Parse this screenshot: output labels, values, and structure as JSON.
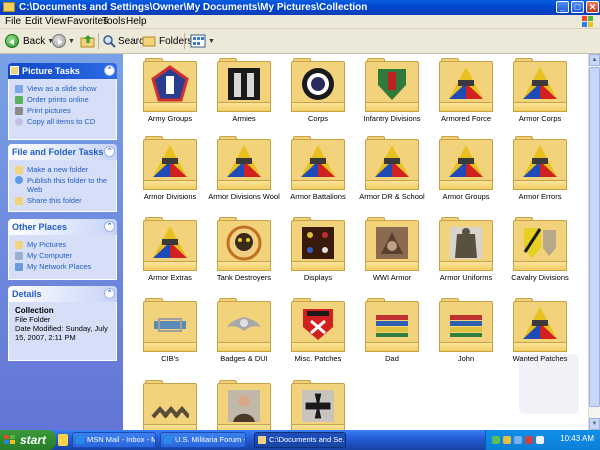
{
  "window": {
    "title": "C:\\Documents and Settings\\Owner\\My Documents\\My Pictures\\Collection",
    "min_label": "_",
    "max_label": "□",
    "close_label": "✕"
  },
  "menu": [
    "File",
    "Edit",
    "View",
    "Favorites",
    "Tools",
    "Help"
  ],
  "toolbar": {
    "back_label": "Back",
    "search_label": "Search",
    "folders_label": "Folders"
  },
  "picture_tasks": {
    "title": "Picture Tasks",
    "items": [
      "View as a slide show",
      "Order prints online",
      "Print pictures",
      "Copy all items to CD"
    ]
  },
  "file_tasks": {
    "title": "File and Folder Tasks",
    "items": [
      "Make a new folder",
      "Publish this folder to the Web",
      "Share this folder"
    ]
  },
  "other_places": {
    "title": "Other Places",
    "items": [
      "My Pictures",
      "My Computer",
      "My Network Places"
    ]
  },
  "details": {
    "title": "Details",
    "name": "Collection",
    "type": "File Folder",
    "modified": "Date Modified: Sunday, July 15, 2007, 2:11 PM"
  },
  "folders": [
    {
      "name": "Army Groups",
      "thumb": "patch-pentagon"
    },
    {
      "name": "Armies",
      "thumb": "patch-a"
    },
    {
      "name": "Corps",
      "thumb": "patch-circle"
    },
    {
      "name": "Infantry Divisions",
      "thumb": "patch-shield-red"
    },
    {
      "name": "Armored Force",
      "thumb": "patch-armor"
    },
    {
      "name": "Armor Corps",
      "thumb": "patch-armor"
    },
    {
      "name": "Armor Divisions",
      "thumb": "patch-armor"
    },
    {
      "name": "Armor Divisions Wool",
      "thumb": "patch-armor"
    },
    {
      "name": "Armor Battalions",
      "thumb": "patch-armor"
    },
    {
      "name": "Armor DR & School",
      "thumb": "patch-armor"
    },
    {
      "name": "Armor Groups",
      "thumb": "patch-armor"
    },
    {
      "name": "Armor Errors",
      "thumb": "patch-armor"
    },
    {
      "name": "Armor Extras",
      "thumb": "patch-armor"
    },
    {
      "name": "Tank Destroyers",
      "thumb": "patch-tiger"
    },
    {
      "name": "Displays",
      "thumb": "patch-display"
    },
    {
      "name": "WWI Armor",
      "thumb": "patch-wwi"
    },
    {
      "name": "Armor Uniforms",
      "thumb": "patch-uniform"
    },
    {
      "name": "Cavalry Divisions",
      "thumb": "patch-cavalry"
    },
    {
      "name": "CIB's",
      "thumb": "patch-badge"
    },
    {
      "name": "Badges & DUI",
      "thumb": "patch-wings"
    },
    {
      "name": "Misc. Patches",
      "thumb": "patch-red"
    },
    {
      "name": "Dad",
      "thumb": "patch-ribbons"
    },
    {
      "name": "John",
      "thumb": "patch-ribbons"
    },
    {
      "name": "Wanted Patches",
      "thumb": "patch-armor"
    },
    {
      "name": "",
      "thumb": "patch-chevrons"
    },
    {
      "name": "",
      "thumb": "patch-portrait"
    },
    {
      "name": "",
      "thumb": "patch-cross"
    }
  ],
  "taskbar": {
    "start_label": "start",
    "buttons": [
      "MSN Mail - Inbox - MS...",
      "U.S. Militaria Forum -...",
      "C:\\Documents and Se..."
    ],
    "clock": "10:43 AM"
  }
}
